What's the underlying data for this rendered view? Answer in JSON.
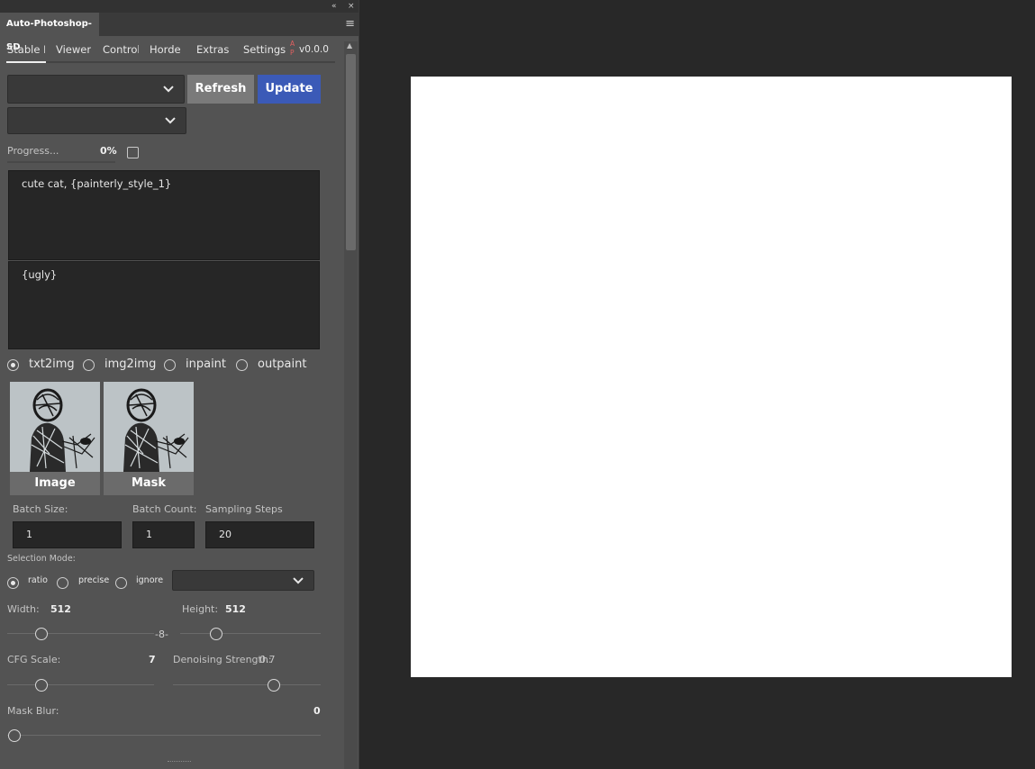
{
  "panel": {
    "title": "Auto-Photoshop-SD",
    "collapse_glyph": "«",
    "close_glyph": "×",
    "menu_glyph": "≡"
  },
  "tabs": {
    "items": [
      "Stable Di",
      "Viewer",
      "Controlt",
      "Horde",
      "Extras",
      "Settings"
    ],
    "active_index": 0,
    "logo_text": [
      "A",
      "P"
    ],
    "version": "v0.0.0"
  },
  "model": {
    "model_select_value": "",
    "second_select_value": "",
    "refresh_label": "Refresh",
    "update_label": "Update"
  },
  "progress": {
    "label": "Progress...",
    "percent_text": "0%",
    "value": 0
  },
  "prompts": {
    "positive": "cute cat, {painterly_style_1}",
    "negative": "{ugly}"
  },
  "mode": {
    "options": [
      "txt2img",
      "img2img",
      "inpaint",
      "outpaint"
    ],
    "selected": "txt2img"
  },
  "thumbnails": {
    "image_label": "Image",
    "mask_label": "Mask"
  },
  "batch": {
    "batch_size_label": "Batch Size:",
    "batch_size": "1",
    "batch_count_label": "Batch Count:",
    "batch_count": "1",
    "steps_label": "Sampling Steps",
    "steps": "20"
  },
  "selection": {
    "label": "Selection Mode:",
    "options": [
      "ratio",
      "precise",
      "ignore"
    ],
    "selected": "ratio",
    "select_value": ""
  },
  "dimensions": {
    "width_label": "Width:",
    "width": "512",
    "height_label": "Height:",
    "height": "512",
    "link_glyph": "-8-"
  },
  "cfg": {
    "label": "CFG Scale:",
    "value": "7"
  },
  "denoise": {
    "label": "Denoising Strength:",
    "value": "0.7"
  },
  "mask_blur": {
    "label": "Mask Blur:",
    "value": "0"
  },
  "colors": {
    "canvas_bg": "#282828",
    "panel_bg": "#535353",
    "update_button": "#3b5ab7",
    "refresh_button": "#7a7a7a",
    "document": "#ffffff"
  }
}
